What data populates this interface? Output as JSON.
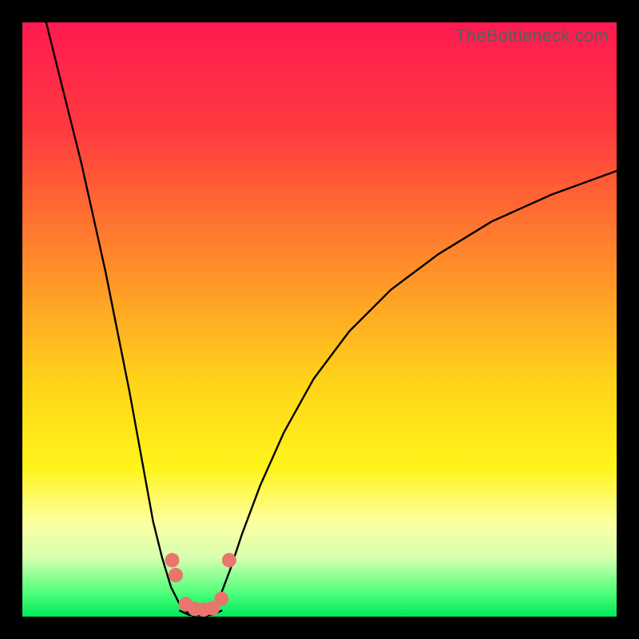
{
  "watermark": "TheBottleneck.com",
  "colors": {
    "gradient_stops": [
      {
        "offset": 0.0,
        "color": "#ff1a51"
      },
      {
        "offset": 0.18,
        "color": "#ff3a3f"
      },
      {
        "offset": 0.4,
        "color": "#ff8a2a"
      },
      {
        "offset": 0.6,
        "color": "#ffd21a"
      },
      {
        "offset": 0.75,
        "color": "#fff41a"
      },
      {
        "offset": 0.84,
        "color": "#fdffa0"
      },
      {
        "offset": 0.9,
        "color": "#d8ffb0"
      },
      {
        "offset": 0.96,
        "color": "#4fff7c"
      },
      {
        "offset": 1.0,
        "color": "#00e85a"
      }
    ],
    "curve": "#000000",
    "markers": "#e8766f",
    "frame": "#000000"
  },
  "chart_data": {
    "type": "line",
    "title": "",
    "xlabel": "",
    "ylabel": "",
    "xlim": [
      0,
      100
    ],
    "ylim": [
      0,
      100
    ],
    "series": [
      {
        "name": "left-curve",
        "x": [
          4,
          6,
          8,
          10,
          12,
          14,
          16,
          18,
          20,
          22,
          23.5,
          25,
          26.5,
          28,
          29
        ],
        "y": [
          100,
          92,
          84,
          76,
          67,
          58,
          48,
          38,
          27,
          16,
          10,
          5,
          2,
          0.5,
          0
        ]
      },
      {
        "name": "right-curve",
        "x": [
          31,
          32,
          33.5,
          35,
          37,
          40,
          44,
          49,
          55,
          62,
          70,
          79,
          89,
          100
        ],
        "y": [
          0,
          1,
          4,
          8,
          14,
          22,
          31,
          40,
          48,
          55,
          61,
          66.5,
          71,
          75
        ]
      },
      {
        "name": "valley-floor",
        "x": [
          26.5,
          28,
          30,
          32,
          33.5
        ],
        "y": [
          1.0,
          0.3,
          0.2,
          0.3,
          1.0
        ]
      }
    ],
    "markers": [
      {
        "name": "m1",
        "x": 25.2,
        "y": 9.5
      },
      {
        "name": "m2",
        "x": 25.8,
        "y": 7.0
      },
      {
        "name": "m3",
        "x": 27.5,
        "y": 2.1
      },
      {
        "name": "m4",
        "x": 29.0,
        "y": 1.3
      },
      {
        "name": "m5",
        "x": 30.5,
        "y": 1.2
      },
      {
        "name": "m6",
        "x": 32.0,
        "y": 1.4
      },
      {
        "name": "m7",
        "x": 33.5,
        "y": 3.0
      },
      {
        "name": "m8",
        "x": 34.8,
        "y": 9.5
      }
    ]
  }
}
